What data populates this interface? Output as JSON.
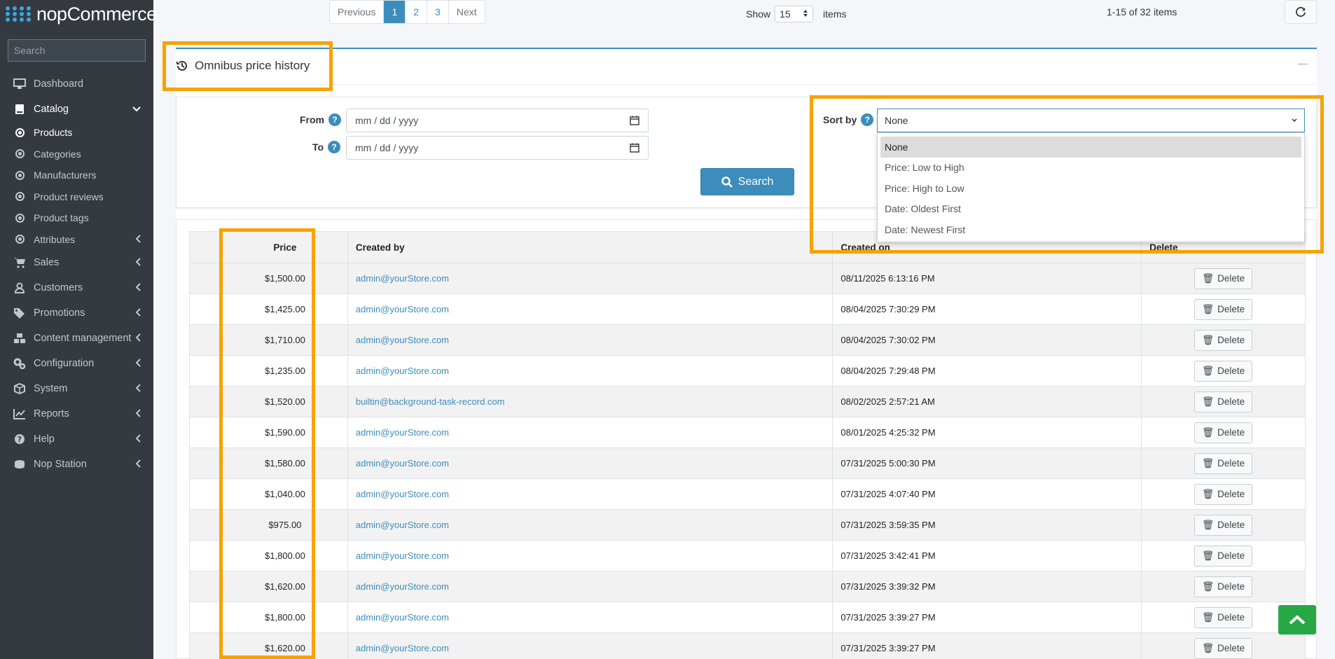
{
  "brand": {
    "name_light": "nop",
    "name_bold": "Commerce"
  },
  "sidebar": {
    "search_placeholder": "Search",
    "items": [
      {
        "label": "Dashboard"
      },
      {
        "label": "Catalog"
      },
      {
        "label": "Products"
      },
      {
        "label": "Categories"
      },
      {
        "label": "Manufacturers"
      },
      {
        "label": "Product reviews"
      },
      {
        "label": "Product tags"
      },
      {
        "label": "Attributes"
      },
      {
        "label": "Sales"
      },
      {
        "label": "Customers"
      },
      {
        "label": "Promotions"
      },
      {
        "label": "Content management"
      },
      {
        "label": "Configuration"
      },
      {
        "label": "System"
      },
      {
        "label": "Reports"
      },
      {
        "label": "Help"
      },
      {
        "label": "Nop Station"
      }
    ]
  },
  "pagination": {
    "previous": "Previous",
    "pages": [
      "1",
      "2",
      "3"
    ],
    "next": "Next",
    "show_label": "Show",
    "show_value": "15",
    "items_label": "items",
    "count_text": "1-15 of 32 items"
  },
  "section": {
    "title": "Omnibus price history",
    "collapse": "—"
  },
  "filters": {
    "from_label": "From",
    "to_label": "To",
    "date_placeholder": "mm / dd / yyyy",
    "sort_label": "Sort by",
    "sort_value": "None",
    "sort_options": [
      "None",
      "Price: Low to High",
      "Price: High to Low",
      "Date: Oldest First",
      "Date: Newest First"
    ],
    "search_button": "Search"
  },
  "table": {
    "headers": {
      "price": "Price",
      "created_by": "Created by",
      "created_on": "Created on",
      "delete": "Delete"
    },
    "delete_label": "Delete",
    "rows": [
      {
        "price": "$1,500.00",
        "created_by": "admin@yourStore.com",
        "created_on": "08/11/2025 6:13:16 PM"
      },
      {
        "price": "$1,425.00",
        "created_by": "admin@yourStore.com",
        "created_on": "08/04/2025 7:30:29 PM"
      },
      {
        "price": "$1,710.00",
        "created_by": "admin@yourStore.com",
        "created_on": "08/04/2025 7:30:02 PM"
      },
      {
        "price": "$1,235.00",
        "created_by": "admin@yourStore.com",
        "created_on": "08/04/2025 7:29:48 PM"
      },
      {
        "price": "$1,520.00",
        "created_by": "builtin@background-task-record.com",
        "created_on": "08/02/2025 2:57:21 AM"
      },
      {
        "price": "$1,590.00",
        "created_by": "admin@yourStore.com",
        "created_on": "08/01/2025 4:25:32 PM"
      },
      {
        "price": "$1,580.00",
        "created_by": "admin@yourStore.com",
        "created_on": "07/31/2025 5:00:30 PM"
      },
      {
        "price": "$1,040.00",
        "created_by": "admin@yourStore.com",
        "created_on": "07/31/2025 4:07:40 PM"
      },
      {
        "price": "$975.00",
        "created_by": "admin@yourStore.com",
        "created_on": "07/31/2025 3:59:35 PM"
      },
      {
        "price": "$1,800.00",
        "created_by": "admin@yourStore.com",
        "created_on": "07/31/2025 3:42:41 PM"
      },
      {
        "price": "$1,620.00",
        "created_by": "admin@yourStore.com",
        "created_on": "07/31/2025 3:39:32 PM"
      },
      {
        "price": "$1,800.00",
        "created_by": "admin@yourStore.com",
        "created_on": "07/31/2025 3:39:27 PM"
      },
      {
        "price": "$1,620.00",
        "created_by": "admin@yourStore.com",
        "created_on": "07/31/2025 3:39:27 PM"
      }
    ]
  },
  "colors": {
    "accent": "#3c8dbc",
    "highlight": "#f5a300",
    "sidebar_bg": "#343a40",
    "scroll_top": "#28a745"
  }
}
